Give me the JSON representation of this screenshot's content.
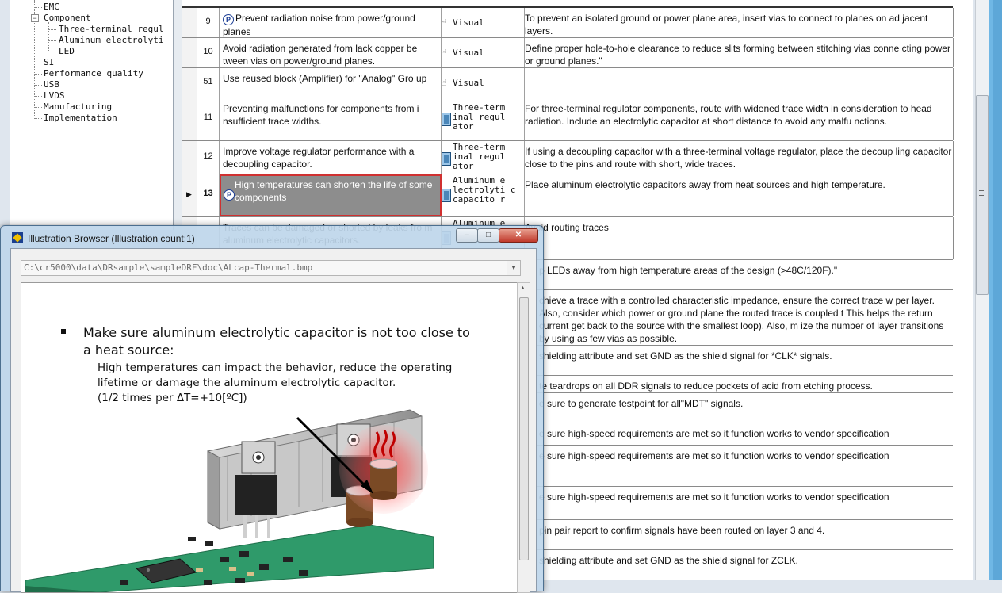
{
  "tree": {
    "items": [
      {
        "label": "EMC",
        "level": 1
      },
      {
        "label": "Component",
        "level": 1,
        "expanded": true
      },
      {
        "label": "Three-terminal regul",
        "level": 2
      },
      {
        "label": "Aluminum electrolyti",
        "level": 2
      },
      {
        "label": "LED",
        "level": 2
      },
      {
        "label": "SI",
        "level": 1
      },
      {
        "label": "Performance quality",
        "level": 1
      },
      {
        "label": "USB",
        "level": 1
      },
      {
        "label": "LVDS",
        "level": 1
      },
      {
        "label": "Manufacturing",
        "level": 1
      },
      {
        "label": "Implementation",
        "level": 1
      }
    ]
  },
  "grid": {
    "rows": [
      {
        "num": "9",
        "title": "Prevent radiation noise from power/ground planes",
        "title_icon": "p-icon",
        "category": "Visual",
        "cat_icon": "hand-icon",
        "desc": "To prevent an isolated ground or power plane area, insert vias to connect to planes on ad jacent layers."
      },
      {
        "num": "10",
        "title": "Avoid radiation generated from lack copper be tween vias on power/ground planes.",
        "category": "Visual",
        "cat_icon": "hand-icon",
        "desc": "Define proper hole-to-hole clearance to reduce slits forming between stitching vias conne cting power or ground planes.\""
      },
      {
        "num": "51",
        "title": "Use reused block (Amplifier) for \"Analog\" Gro up",
        "category": "Visual",
        "cat_icon": "hand-icon",
        "desc": ""
      },
      {
        "num": "11",
        "title": "Preventing malfunctions for components from i nsufficient trace widths.",
        "category": "Three-term inal regul ator",
        "cat_icon": "component-icon",
        "desc": "For three-terminal regulator components, route with widened trace width in consideration to head radiation. Include an electrolytic capacitor at short distance to avoid any malfu nctions."
      },
      {
        "num": "12",
        "title": "Improve voltage regulator performance with a decoupling capacitor.",
        "category": "Three-term inal regul ator",
        "cat_icon": "component-icon",
        "desc": "If using a decoupling capacitor with a three-terminal voltage regulator, place the decoup ling capacitor close to the pins and route with short, wide traces."
      },
      {
        "num": "13",
        "title": "High temperatures can shorten the life of some components",
        "title_icon": "p-icon",
        "selected": true,
        "category": "Aluminum e lectrolyti c capacito r",
        "cat_icon": "component-icon",
        "desc": "Place aluminum electrolytic capacitors away from heat sources and high temperature."
      },
      {
        "num": "",
        "title": "Traces can be damaged or shorted by leaks fro m aluminum electrolytic capacitors.",
        "category": "Aluminum e",
        "cat_icon": "component-icon",
        "desc": "Avoid routing traces"
      },
      {
        "num": "",
        "title": "",
        "category": "",
        "desc": "p LEDs away from high temperature areas of the design (>48C/120F).\""
      },
      {
        "num": "",
        "title": "",
        "category": "",
        "desc": "chieve a trace with a controlled characteristic impedance, ensure the correct trace w per layer.  Also, consider which power or ground plane the routed trace is coupled t This helps the return current get back to the source with the smallest loop). Also, m ize the number of layer transitions by using as few vias as possible."
      },
      {
        "num": "",
        "title": "",
        "category": "",
        "desc": "shielding attribute and set GND as the shield signal for *CLK* signals."
      },
      {
        "num": "",
        "title": "",
        "category": "",
        "desc": "te teardrops on all DDR signals to reduce pockets of acid from etching process."
      },
      {
        "num": "",
        "title": "",
        "category": "",
        "desc": "e sure to generate testpoint for all\"MDT\" signals."
      },
      {
        "num": "",
        "title": "",
        "category": "",
        "desc": "e sure high-speed requirements are met so it function works to vendor specification"
      },
      {
        "num": "",
        "title": "",
        "category": "",
        "desc": "e sure high-speed requirements are met so it function works to vendor specification"
      },
      {
        "num": "",
        "title": "",
        "category": "",
        "desc": "e sure high-speed requirements are met so it function works to vendor specification"
      },
      {
        "num": "",
        "title": "",
        "category": "",
        "desc": "pin pair report to confirm signals have been routed on layer 3 and 4."
      },
      {
        "num": "",
        "title": "",
        "category": "",
        "desc": "shielding attribute and set GND as the shield signal for ZCLK."
      }
    ]
  },
  "illustration_browser": {
    "title": "Illustration Browser (Illustration count:1)",
    "path": "C:\\cr5000\\data\\DRsample\\sampleDRF\\doc\\ALcap-Thermal.bmp",
    "heading": "Make sure aluminum electrolytic capacitor is not too close to a heat source:",
    "body_line1": "High temperatures can impact the behavior, reduce the operating",
    "body_line2": "lifetime or damage the aluminum electrolytic capacitor.",
    "body_line3": "(1/2 times  per ΔT=+10[ºC])",
    "min_symbol": "–",
    "max_symbol": "□",
    "close_symbol": "✕"
  },
  "colors": {
    "selection_border": "#d03030",
    "selection_fill": "#8d8d8d",
    "window_frame": "#bed6ea",
    "pcb_green": "#2f9a6a"
  }
}
